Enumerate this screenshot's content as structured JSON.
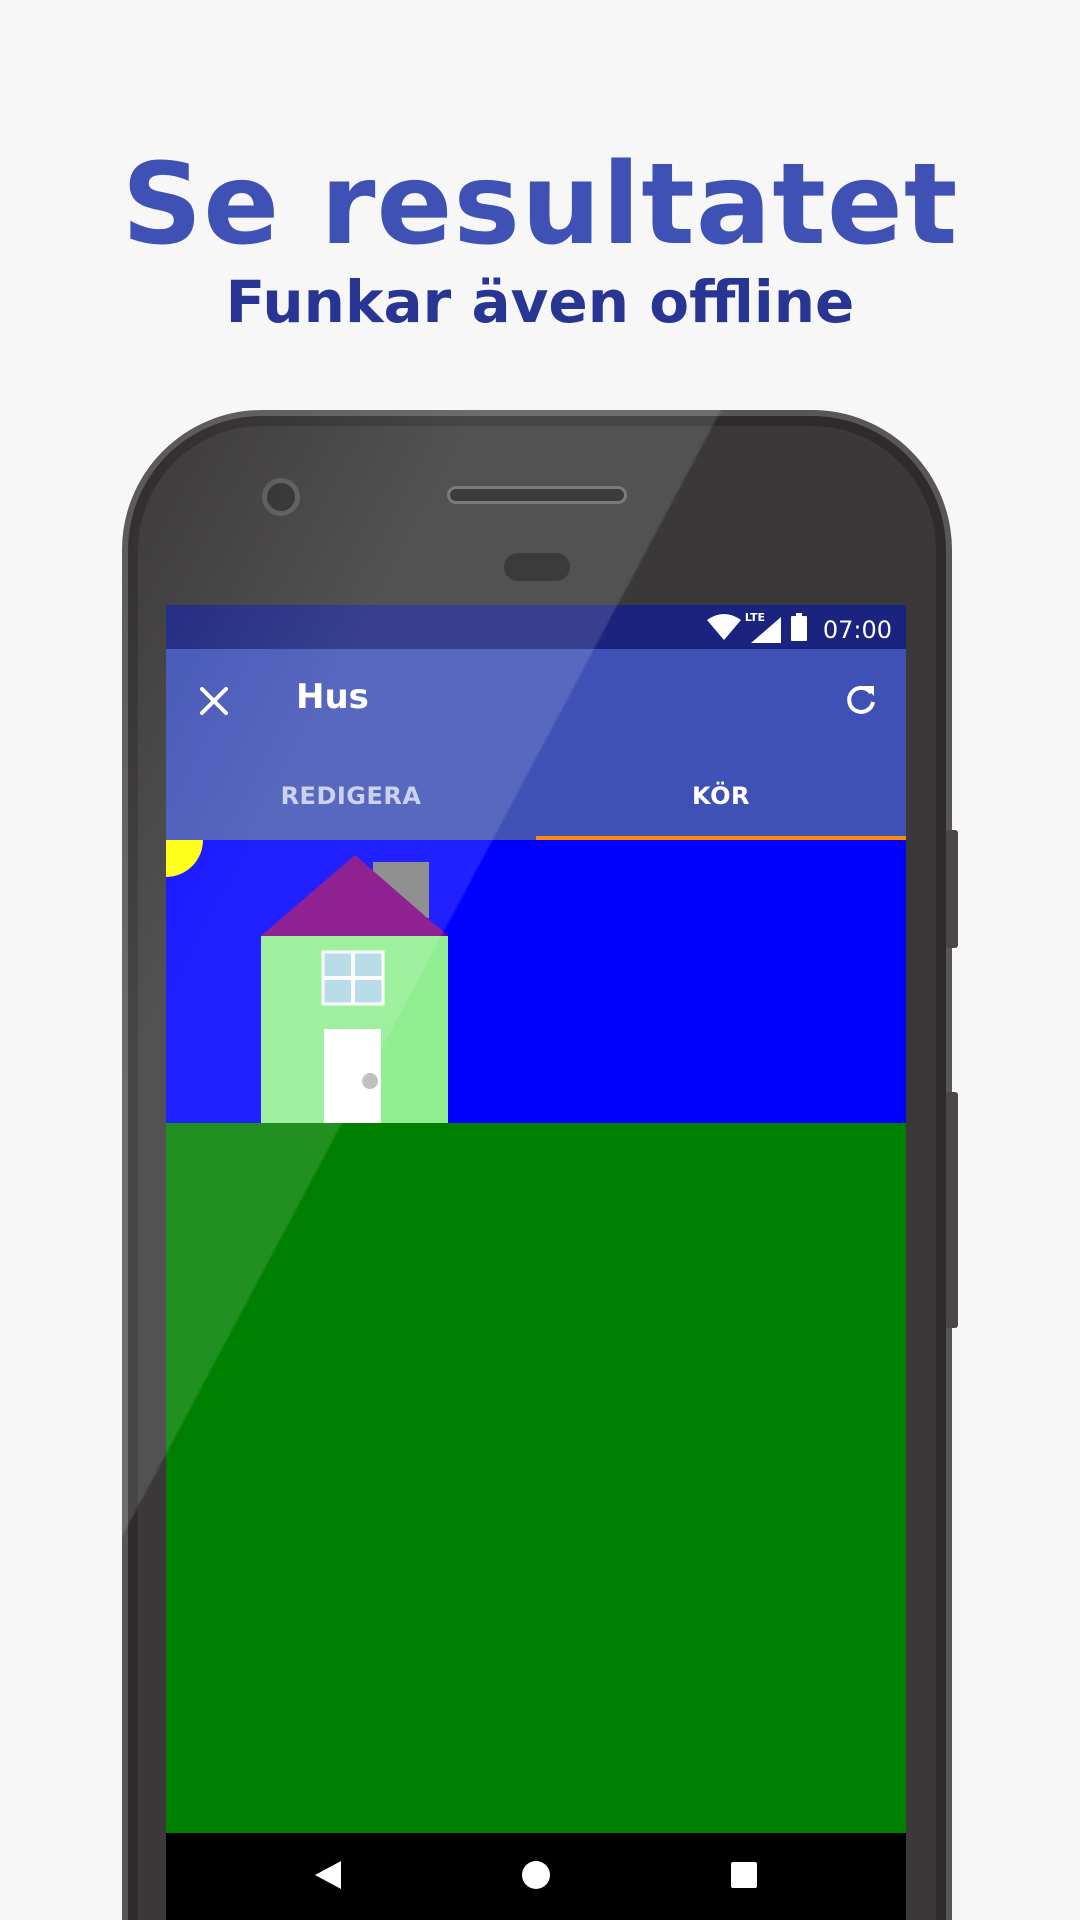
{
  "promo": {
    "headline": "Se resultatet",
    "subline": "Funkar även offline"
  },
  "status_bar": {
    "time": "07:00",
    "network": "LTE",
    "icons": [
      "wifi-icon",
      "signal-icon",
      "battery-icon"
    ]
  },
  "app_bar": {
    "title": "Hus",
    "close_icon": "close-icon",
    "refresh_icon": "refresh-icon"
  },
  "tabs": [
    {
      "label": "REDIGERA",
      "active": false
    },
    {
      "label": "KÖR",
      "active": true
    }
  ],
  "colors": {
    "primary": "#3f51b5",
    "primary_dark": "#1a237e",
    "accent": "#ff8a00",
    "sky": "#0000ff",
    "grass": "#008000",
    "house_wall": "#90ee90",
    "roof": "#800080",
    "chimney": "#808080",
    "sun": "#ffff00",
    "window": "#add8e6",
    "door": "#ffffff",
    "door_knob": "#c0c0c0"
  },
  "nav_bar": {
    "icons": [
      "back-icon",
      "home-icon",
      "recents-icon"
    ]
  }
}
